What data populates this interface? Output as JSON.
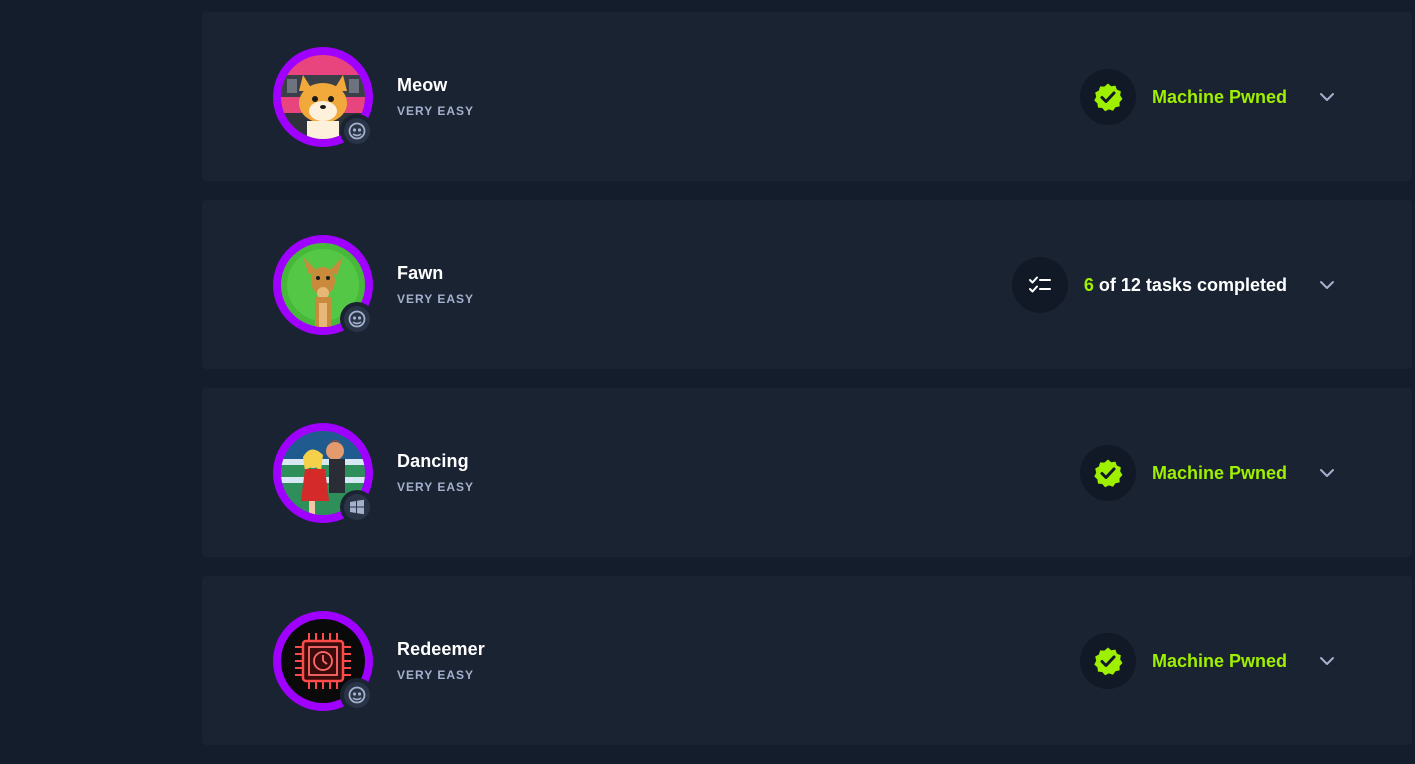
{
  "machines": [
    {
      "name": "Meow",
      "difficulty": "VERY EASY",
      "os": "linux-icon",
      "status_type": "pwned",
      "status_text": "Machine Pwned"
    },
    {
      "name": "Fawn",
      "difficulty": "VERY EASY",
      "os": "linux-icon",
      "status_type": "tasks",
      "tasks_done": "6",
      "tasks_rest": "of 12 tasks completed"
    },
    {
      "name": "Dancing",
      "difficulty": "VERY EASY",
      "os": "windows-icon",
      "status_type": "pwned",
      "status_text": "Machine Pwned"
    },
    {
      "name": "Redeemer",
      "difficulty": "VERY EASY",
      "os": "linux-icon",
      "status_type": "pwned",
      "status_text": "Machine Pwned"
    }
  ],
  "colors": {
    "background": "#141d2b",
    "card": "#1a2332",
    "accent_green": "#9fef00",
    "ring_purple": "#9f00ff",
    "muted_text": "#a4b1cd"
  }
}
